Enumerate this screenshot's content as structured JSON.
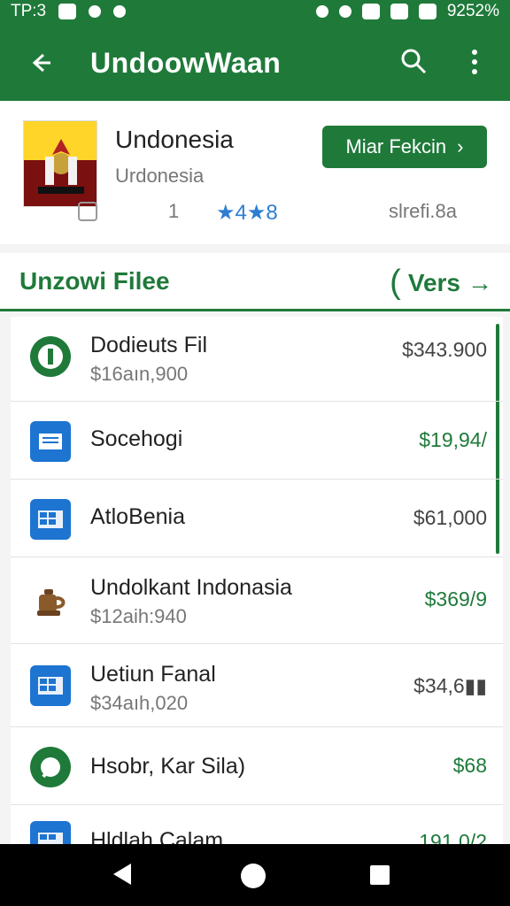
{
  "status_bar": {
    "time": "TP:3",
    "battery": "9252%"
  },
  "app_bar": {
    "title": "UndoowWaan",
    "icons": [
      "back-arrow-icon",
      "search-icon",
      "more-vert-icon"
    ]
  },
  "hero": {
    "title": "Undonesia",
    "subtitle": "Urdonesia",
    "cta_label": "Miar Fekcin",
    "cta_icon": "chevron-right-icon",
    "count": "1",
    "rating": "★4★8",
    "size": "slrefi.8a"
  },
  "section": {
    "label": "Unzowi Filee",
    "versions_label": "Vers",
    "versions_icon": "arrow-right-icon"
  },
  "rows": [
    {
      "name": "Dodieuts Fil",
      "sub": "$16aın,900",
      "price": "$343.900",
      "price_color": "gray",
      "icon": "green-phone-icon"
    },
    {
      "name": "Socehogi",
      "sub": "",
      "price": "$19,94/",
      "price_color": "green",
      "icon": "blue-document-icon"
    },
    {
      "name": "AtloBenia",
      "sub": "",
      "price": "$61,000",
      "price_color": "gray",
      "icon": "blue-grid-icon"
    },
    {
      "name": "Undolkant Indonasia",
      "sub": "$12aih:940",
      "price": "$369/9",
      "price_color": "green",
      "icon": "brown-kettle-icon"
    },
    {
      "name": "Uetiun Fanal",
      "sub": "$34aıh,020",
      "price": "$34,6▮▮",
      "price_color": "gray",
      "icon": "blue-grid-icon"
    },
    {
      "name": "Hsobr, Kar Sila)",
      "sub": "",
      "price": "$68",
      "price_color": "green",
      "icon": "green-chat-icon"
    },
    {
      "name": "Hldlah Calam",
      "sub": "",
      "price": "191,0/2",
      "price_color": "green",
      "icon": "blue-grid-icon"
    }
  ],
  "colors": {
    "primary": "#1f7a3a",
    "rating_blue": "#2f7dd0"
  }
}
